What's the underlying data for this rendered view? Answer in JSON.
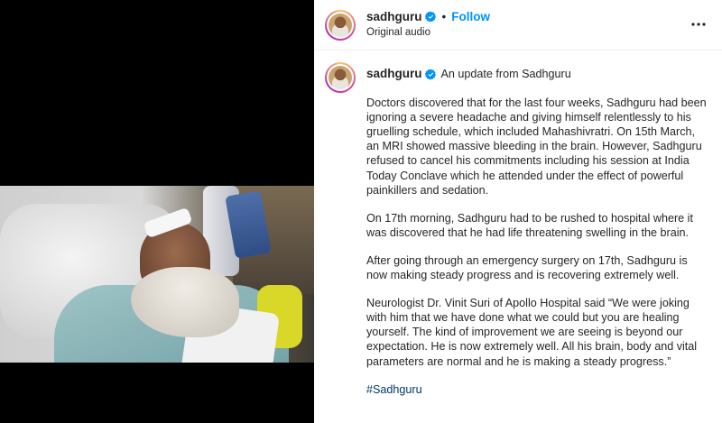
{
  "post": {
    "username": "sadhguru",
    "follow_label": "Follow",
    "separator": "•",
    "audio_label": "Original audio",
    "more_icon": "more-options-icon",
    "verified_color": "#0095f6"
  },
  "caption": {
    "username": "sadhguru",
    "title": "An update from Sadhguru",
    "paragraphs": [
      "Doctors discovered that for the last four weeks, Sadhguru had been ignoring a severe headache and giving himself relentlessly to his gruelling schedule, which included Mahashivratri. On 15th March, an MRI showed massive bleeding in the brain. However, Sadhguru refused to cancel his commitments including his session at India Today Conclave which he attended under the effect of powerful painkillers and sedation.",
      "On 17th morning, Sadhguru had to be rushed to hospital where it was discovered that he had life threatening swelling in the brain.",
      "After going through an emergency surgery on 17th, Sadhguru is now making steady progress and is recovering extremely well.",
      "Neurologist Dr. Vinit Suri of Apollo Hospital said “We were joking with him that we have done what we could but you are healing yourself. The kind of improvement we are seeing is beyond our expectation. He is now extremely well. All his brain, body and vital parameters are normal and he is making a steady progress.”"
    ],
    "hashtag": "#Sadhguru"
  }
}
